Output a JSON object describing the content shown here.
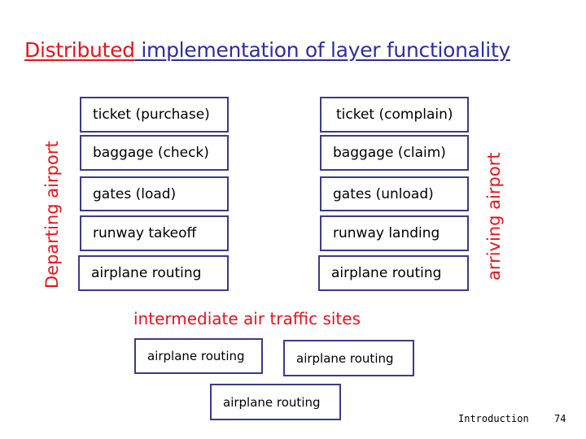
{
  "title": {
    "highlight": "Distributed",
    "rest": " implementation of layer functionality",
    "highlight_color": "#e8141c",
    "rest_color": "#2d2fa0"
  },
  "departing": {
    "label": "Departing airport",
    "layers": [
      "ticket (purchase)",
      "baggage (check)",
      "gates (load)",
      "runway takeoff",
      "airplane routing"
    ]
  },
  "arriving": {
    "label": "arriving airport",
    "layers": [
      "ticket (complain)",
      "baggage (claim)",
      "gates (unload)",
      "runway landing",
      "airplane routing"
    ]
  },
  "intermediate": {
    "label": "intermediate air traffic sites",
    "boxes": [
      "airplane routing",
      "airplane routing",
      "airplane routing"
    ]
  },
  "footer": {
    "section": "Introduction",
    "page": "74"
  },
  "colors": {
    "label_red": "#e8141c",
    "box_border": "#3b3b8c"
  }
}
